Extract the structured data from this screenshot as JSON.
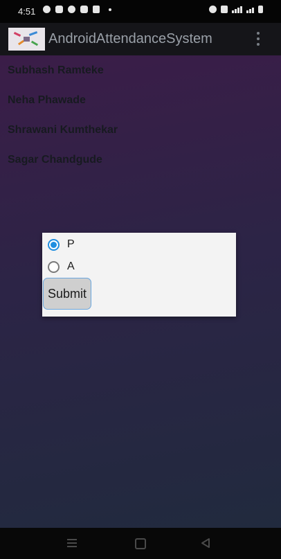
{
  "status_bar": {
    "time": "4:51",
    "left_icons": [
      "whatsapp-icon",
      "youtube-icon",
      "instagram-icon",
      "gmail-icon",
      "notification-icon"
    ],
    "right_icons": [
      "alarm-icon",
      "vibrate-icon",
      "signal-icon",
      "battery-icon"
    ]
  },
  "app_bar": {
    "title": "AndroidAttendanceSystem",
    "menu_icon": "overflow-menu-icon"
  },
  "students": [
    "Subhash Ramteke",
    "Neha  Phawade",
    "Shrawani  Kumthekar",
    "Sagar Chandgude"
  ],
  "dialog": {
    "options": [
      {
        "label": "P",
        "selected": true
      },
      {
        "label": "A",
        "selected": false
      }
    ],
    "submit_label": "Submit"
  },
  "nav_bar": {
    "icons": [
      "menu-icon",
      "home-icon",
      "back-icon"
    ]
  },
  "colors": {
    "accent": "#1f8ee0",
    "app_bar": "#151519",
    "background_top": "#3b1d48",
    "background_bottom": "#212a3e",
    "dialog_bg": "#f3f3f3"
  }
}
